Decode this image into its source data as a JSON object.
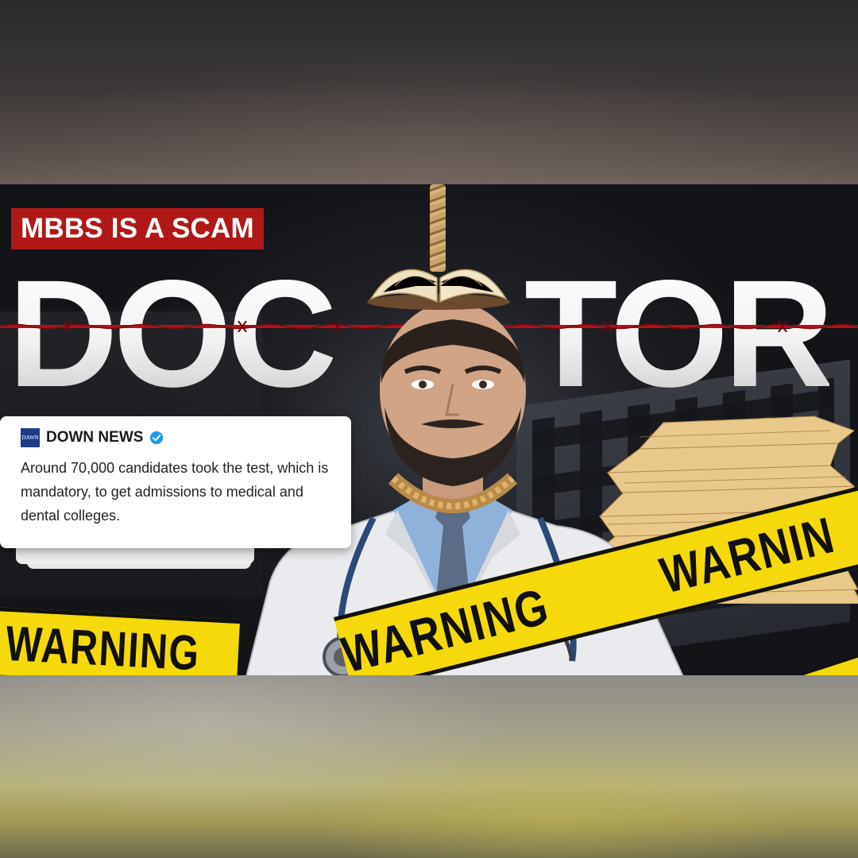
{
  "badge": {
    "text": "MBBS IS A SCAM"
  },
  "headline": {
    "left": "DOC",
    "right": "TOR"
  },
  "news": {
    "logo_text": "DAWN",
    "source": "DOWN NEWS",
    "body": "Around 70,000 candidates took the test, which is mandatory, to get admissions to medical and dental colleges."
  },
  "tapes": {
    "left": "WARNING",
    "main_1": "WARNING",
    "main_2": "WARNIN"
  },
  "icons": {
    "verified": "verified-check-icon"
  },
  "colors": {
    "badge_red": "#b01818",
    "wire_red": "#c0141a",
    "tape_yellow": "#f5d90a",
    "verified_blue": "#1d9bf0"
  }
}
